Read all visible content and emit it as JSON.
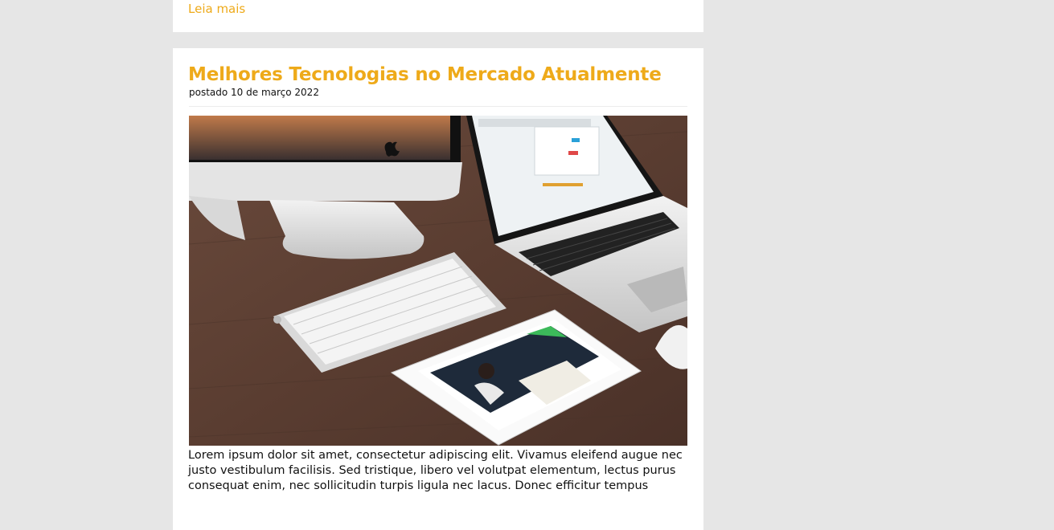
{
  "previous_post": {
    "read_more_label": "Leia mais"
  },
  "post": {
    "title": "Melhores Tecnologias no Mercado Atualmente",
    "date_line": "postado 10 de março 2022",
    "image_icon": "photo-desk-devices",
    "excerpt": "Lorem ipsum dolor sit amet, consectetur adipiscing elit. Vivamus eleifend augue nec justo vestibulum facilisis. Sed tristique, libero vel volutpat elementum, lectus purus consequat enim, nec sollicitudin turpis ligula nec lacus. Donec efficitur tempus"
  },
  "colors": {
    "accent": "#eeaa1a",
    "page_background": "#e6e6e6",
    "card_background": "#ffffff"
  }
}
